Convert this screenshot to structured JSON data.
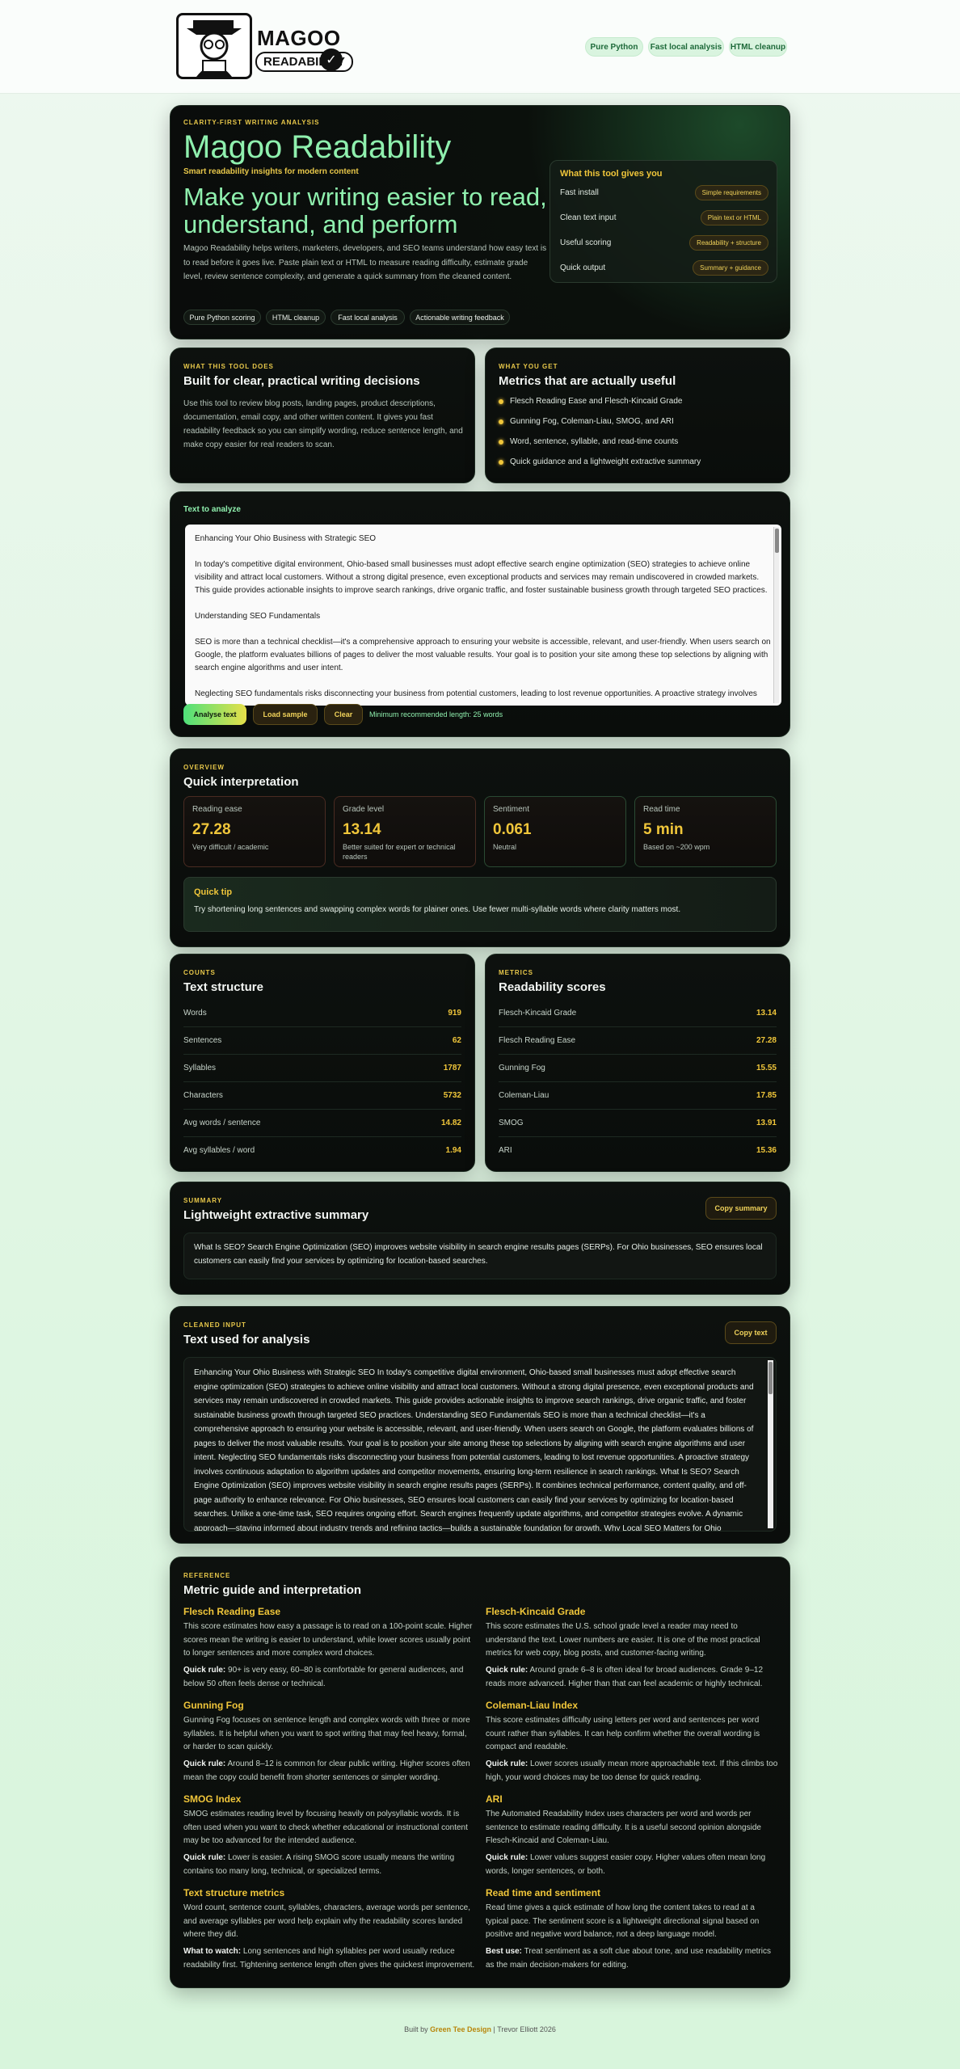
{
  "brand": {
    "title": "MAGOO",
    "subtitle": "READABILITY"
  },
  "nav": [
    "Pure Python",
    "Fast local analysis",
    "HTML cleanup"
  ],
  "hero": {
    "eyebrow": "CLARITY-FIRST WRITING ANALYSIS",
    "title": "Magoo Readability",
    "tagline": "Smart readability insights for modern content",
    "headline": "Make your writing easier to read, understand, and perform",
    "description": "Magoo Readability helps writers, marketers, developers, and SEO teams understand how easy text is to read before it goes live. Paste plain text or HTML to measure reading difficulty, estimate grade level, review sentence complexity, and generate a quick summary from the cleaned content.",
    "chips": [
      "Pure Python scoring",
      "HTML cleanup",
      "Fast local analysis",
      "Actionable writing feedback"
    ],
    "gives": {
      "title": "What this tool gives you",
      "rows": [
        {
          "label": "Fast install",
          "tag": "Simple requirements"
        },
        {
          "label": "Clean text input",
          "tag": "Plain text or HTML"
        },
        {
          "label": "Useful scoring",
          "tag": "Readability + structure"
        },
        {
          "label": "Quick output",
          "tag": "Summary + guidance"
        }
      ]
    }
  },
  "what_does": {
    "eyebrow": "WHAT THIS TOOL DOES",
    "title": "Built for clear, practical writing decisions",
    "body": "Use this tool to review blog posts, landing pages, product descriptions, documentation, email copy, and other written content. It gives you fast readability feedback so you can simplify wording, reduce sentence length, and make copy easier for real readers to scan."
  },
  "what_get": {
    "eyebrow": "WHAT YOU GET",
    "title": "Metrics that are actually useful",
    "items": [
      "Flesch Reading Ease and Flesch-Kincaid Grade",
      "Gunning Fog, Coleman-Liau, SMOG, and ARI",
      "Word, sentence, syllable, and read-time counts",
      "Quick guidance and a lightweight extractive summary"
    ]
  },
  "analyze": {
    "label": "Text to analyze",
    "text_lines": [
      "Enhancing Your Ohio Business with Strategic SEO",
      "",
      "In today's competitive digital environment, Ohio-based small businesses must adopt effective search engine optimization (SEO) strategies to achieve online",
      "visibility and attract local customers. Without a strong digital presence, even exceptional products and services may remain undiscovered in crowded markets.",
      "This guide provides actionable insights to improve search rankings, drive organic traffic, and foster sustainable business growth through targeted SEO practices.",
      "",
      "Understanding SEO Fundamentals",
      "",
      "SEO is more than a technical checklist—it's a comprehensive approach to ensuring your website is accessible, relevant, and user-friendly. When users search on",
      "Google, the platform evaluates billions of pages to deliver the most valuable results. Your goal is to position your site among these top selections by aligning with",
      "search engine algorithms and user intent.",
      "",
      "Neglecting SEO fundamentals risks disconnecting your business from potential customers, leading to lost revenue opportunities. A proactive strategy involves"
    ],
    "btn_analyze": "Analyse text",
    "btn_sample": "Load sample",
    "btn_clear": "Clear",
    "hint": "Minimum recommended length: 25 words"
  },
  "overview": {
    "eyebrow": "OVERVIEW",
    "title": "Quick interpretation",
    "stats": [
      {
        "label": "Reading ease",
        "value": "27.28",
        "note": "Very difficult / academic"
      },
      {
        "label": "Grade level",
        "value": "13.14",
        "note": "Better suited for expert or technical readers"
      },
      {
        "label": "Sentiment",
        "value": "0.061",
        "note": "Neutral"
      },
      {
        "label": "Read time",
        "value": "5 min",
        "note": "Based on ~200 wpm"
      }
    ],
    "tip_title": "Quick tip",
    "tip_body": "Try shortening long sentences and swapping complex words for plainer ones. Use fewer multi-syllable words where clarity matters most."
  },
  "counts": {
    "eyebrow": "COUNTS",
    "title": "Text structure",
    "rows": [
      {
        "k": "Words",
        "v": "919"
      },
      {
        "k": "Sentences",
        "v": "62"
      },
      {
        "k": "Syllables",
        "v": "1787"
      },
      {
        "k": "Characters",
        "v": "5732"
      },
      {
        "k": "Avg words / sentence",
        "v": "14.82"
      },
      {
        "k": "Avg syllables / word",
        "v": "1.94"
      }
    ]
  },
  "metrics": {
    "eyebrow": "METRICS",
    "title": "Readability scores",
    "rows": [
      {
        "k": "Flesch-Kincaid Grade",
        "v": "13.14"
      },
      {
        "k": "Flesch Reading Ease",
        "v": "27.28"
      },
      {
        "k": "Gunning Fog",
        "v": "15.55"
      },
      {
        "k": "Coleman-Liau",
        "v": "17.85"
      },
      {
        "k": "SMOG",
        "v": "13.91"
      },
      {
        "k": "ARI",
        "v": "15.36"
      }
    ]
  },
  "summary": {
    "eyebrow": "SUMMARY",
    "title": "Lightweight extractive summary",
    "copy": "Copy summary",
    "body": "What Is SEO? Search Engine Optimization (SEO) improves website visibility in search engine results pages (SERPs). For Ohio businesses, SEO ensures local customers can easily find your services by optimizing for location-based searches."
  },
  "cleaned": {
    "eyebrow": "CLEANED INPUT",
    "title": "Text used for analysis",
    "copy": "Copy text",
    "body": "Enhancing Your Ohio Business with Strategic SEO In today's competitive digital environment, Ohio-based small businesses must adopt effective search engine optimization (SEO) strategies to achieve online visibility and attract local customers. Without a strong digital presence, even exceptional products and services may remain undiscovered in crowded markets. This guide provides actionable insights to improve search rankings, drive organic traffic, and foster sustainable business growth through targeted SEO practices. Understanding SEO Fundamentals SEO is more than a technical checklist—it's a comprehensive approach to ensuring your website is accessible, relevant, and user-friendly. When users search on Google, the platform evaluates billions of pages to deliver the most valuable results. Your goal is to position your site among these top selections by aligning with search engine algorithms and user intent. Neglecting SEO fundamentals risks disconnecting your business from potential customers, leading to lost revenue opportunities. A proactive strategy involves continuous adaptation to algorithm updates and competitor movements, ensuring long-term resilience in search rankings. What Is SEO? Search Engine Optimization (SEO) improves website visibility in search engine results pages (SERPs). It combines technical performance, content quality, and off-page authority to enhance relevance. For Ohio businesses, SEO ensures local customers can easily find your services by optimizing for location-based searches. Unlike a one-time task, SEO requires ongoing effort. Search engines frequently update algorithms, and competitor strategies evolve. A dynamic approach—staying informed about industry trends and refining tactics—builds a sustainable foundation for growth. Why Local SEO Matters for Ohio Businesses For local enterprises, SEO offers a"
  },
  "reference": {
    "eyebrow": "REFERENCE",
    "title": "Metric guide and interpretation",
    "items": [
      {
        "h": "Flesch Reading Ease",
        "p": "This score estimates how easy a passage is to read on a 100-point scale. Higher scores mean the writing is easier to understand, while lower scores usually point to longer sentences and more complex word choices.",
        "rule_label": "Quick rule:",
        "rule": "90+ is very easy, 60–80 is comfortable for general audiences, and below 50 often feels dense or technical."
      },
      {
        "h": "Flesch-Kincaid Grade",
        "p": "This score estimates the U.S. school grade level a reader may need to understand the text. Lower numbers are easier. It is one of the most practical metrics for web copy, blog posts, and customer-facing writing.",
        "rule_label": "Quick rule:",
        "rule": "Around grade 6–8 is often ideal for broad audiences. Grade 9–12 reads more advanced. Higher than that can feel academic or highly technical."
      },
      {
        "h": "Gunning Fog",
        "p": "Gunning Fog focuses on sentence length and complex words with three or more syllables. It is helpful when you want to spot writing that may feel heavy, formal, or harder to scan quickly.",
        "rule_label": "Quick rule:",
        "rule": "Around 8–12 is common for clear public writing. Higher scores often mean the copy could benefit from shorter sentences or simpler wording."
      },
      {
        "h": "Coleman-Liau Index",
        "p": "This score estimates difficulty using letters per word and sentences per word count rather than syllables. It can help confirm whether the overall wording is compact and readable.",
        "rule_label": "Quick rule:",
        "rule": "Lower scores usually mean more approachable text. If this climbs too high, your word choices may be too dense for quick reading."
      },
      {
        "h": "SMOG Index",
        "p": "SMOG estimates reading level by focusing heavily on polysyllabic words. It is often used when you want to check whether educational or instructional content may be too advanced for the intended audience.",
        "rule_label": "Quick rule:",
        "rule": "Lower is easier. A rising SMOG score usually means the writing contains too many long, technical, or specialized terms."
      },
      {
        "h": "ARI",
        "p": "The Automated Readability Index uses characters per word and words per sentence to estimate reading difficulty. It is a useful second opinion alongside Flesch-Kincaid and Coleman-Liau.",
        "rule_label": "Quick rule:",
        "rule": "Lower values suggest easier copy. Higher values often mean long words, longer sentences, or both."
      },
      {
        "h": "Text structure metrics",
        "p": "Word count, sentence count, syllables, characters, average words per sentence, and average syllables per word help explain why the readability scores landed where they did.",
        "rule_label": "What to watch:",
        "rule": "Long sentences and high syllables per word usually reduce readability first. Tightening sentence length often gives the quickest improvement."
      },
      {
        "h": "Read time and sentiment",
        "p": "Read time gives a quick estimate of how long the content takes to read at a typical pace. The sentiment score is a lightweight directional signal based on positive and negative word balance, not a deep language model.",
        "rule_label": "Best use:",
        "rule": "Treat sentiment as a soft clue about tone, and use readability metrics as the main decision-makers for editing."
      }
    ]
  },
  "footer": {
    "prefix": "Built by",
    "link": "Green Tee Design",
    "suffix": "| Trevor Elliott 2026"
  }
}
